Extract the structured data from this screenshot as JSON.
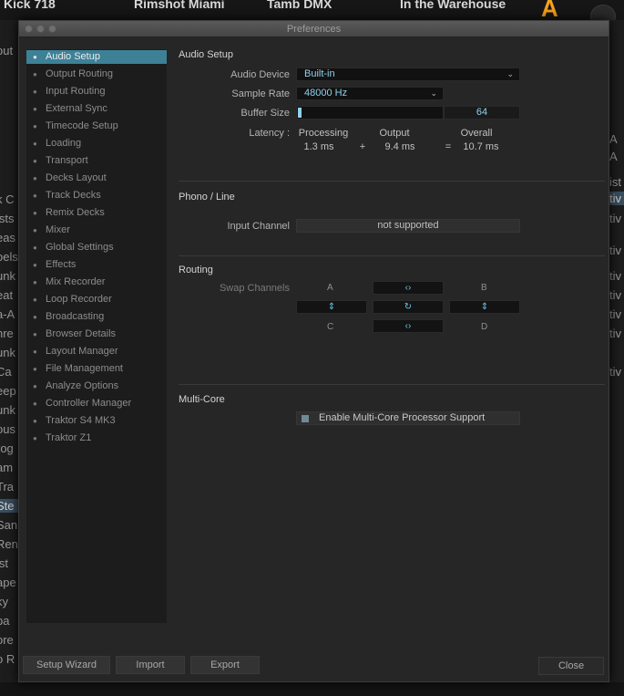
{
  "background": {
    "top_titles": [
      "Kick 718",
      "Rimshot Miami",
      "Tamb DMX",
      "In the Warehouse"
    ],
    "deck_letter": "A",
    "left_fragments": [
      "out",
      "k C",
      "ists",
      "eas",
      "oels",
      "unk",
      "eat",
      "a-A",
      "nre",
      "unk",
      "Ca",
      "eep",
      "unk",
      "ous",
      "rog",
      "am",
      "Tra",
      "Ste",
      "San",
      "Ren",
      "ist",
      "ape",
      "ky",
      "pa",
      "ore",
      "o R"
    ],
    "right_fragments": [
      "A",
      "A",
      "ist",
      "tiv",
      "tiv",
      "tiv",
      "tiv",
      "tiv",
      "tiv",
      "tiv",
      "tiv"
    ]
  },
  "window": {
    "title": "Preferences"
  },
  "sidebar": {
    "items": [
      "Audio Setup",
      "Output Routing",
      "Input Routing",
      "External Sync",
      "Timecode Setup",
      "Loading",
      "Transport",
      "Decks Layout",
      "Track Decks",
      "Remix Decks",
      "Mixer",
      "Global Settings",
      "Effects",
      "Mix Recorder",
      "Loop Recorder",
      "Broadcasting",
      "Browser Details",
      "Layout Manager",
      "File Management",
      "Analyze Options",
      "Controller Manager",
      "Traktor S4 MK3",
      "Traktor Z1"
    ],
    "active_index": 0
  },
  "audio_setup": {
    "title": "Audio Setup",
    "device_label": "Audio Device",
    "device_value": "Built-in",
    "rate_label": "Sample Rate",
    "rate_value": "48000 Hz",
    "buffer_label": "Buffer Size",
    "buffer_value": "64",
    "buffer_fill": 0.02,
    "latency_label": "Latency :",
    "processing_label": "Processing",
    "processing_value": "1.3 ms",
    "plus": "+",
    "output_label": "Output",
    "output_value": "9.4 ms",
    "equals": "=",
    "overall_label": "Overall",
    "overall_value": "10.7 ms"
  },
  "phono": {
    "title": "Phono / Line",
    "channel_label": "Input Channel",
    "channel_value": "not supported"
  },
  "routing": {
    "title": "Routing",
    "swap_label": "Swap Channels",
    "a": "A",
    "b": "B",
    "c": "C",
    "d": "D",
    "swap_h_glyph": "‹›",
    "swap_v_glyph": "⇕",
    "reset_glyph": "↻"
  },
  "multicore": {
    "title": "Multi-Core",
    "option_label": "Enable Multi-Core Processor Support",
    "enabled": false
  },
  "footer": {
    "setup_wizard": "Setup Wizard",
    "import": "Import",
    "export": "Export",
    "close": "Close"
  },
  "colors": {
    "accent": "#3d8197",
    "value_text": "#8fd1ea"
  }
}
